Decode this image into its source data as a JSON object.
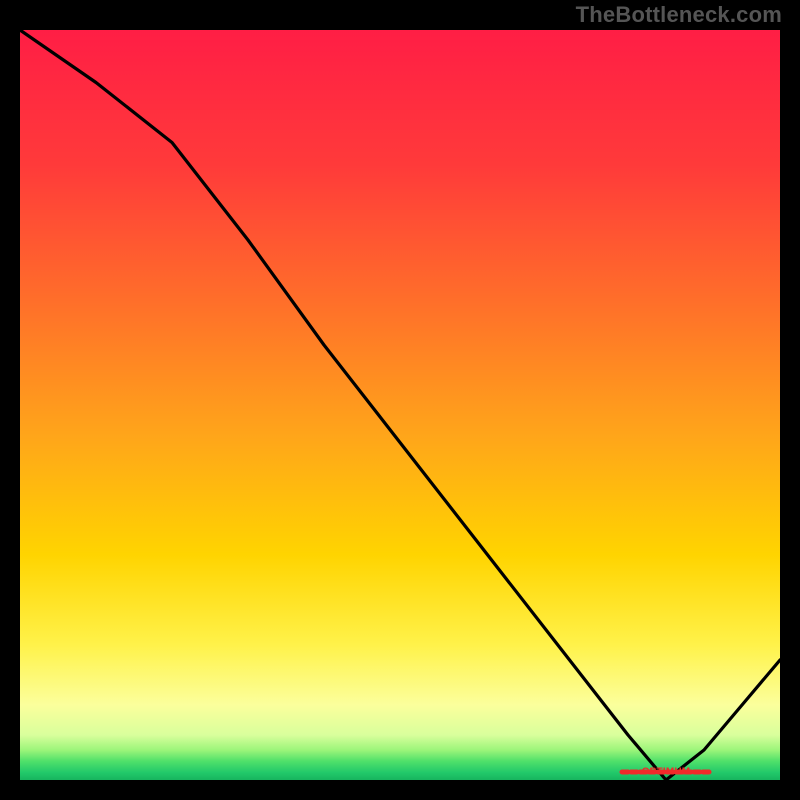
{
  "watermark": "TheBottleneck.com",
  "optimum_marker_text": "OPTIMUM",
  "colors": {
    "gradient_stops": [
      {
        "t": 0.0,
        "c": "#ff1e45"
      },
      {
        "t": 0.18,
        "c": "#ff3a3a"
      },
      {
        "t": 0.36,
        "c": "#ff6e2a"
      },
      {
        "t": 0.54,
        "c": "#ffa51a"
      },
      {
        "t": 0.7,
        "c": "#ffd400"
      },
      {
        "t": 0.82,
        "c": "#fff24a"
      },
      {
        "t": 0.9,
        "c": "#fbff9c"
      },
      {
        "t": 0.94,
        "c": "#d9ff9c"
      },
      {
        "t": 0.96,
        "c": "#9cf57a"
      },
      {
        "t": 0.975,
        "c": "#4fe06a"
      },
      {
        "t": 0.99,
        "c": "#22c96a"
      },
      {
        "t": 1.0,
        "c": "#17b45e"
      }
    ],
    "curve": "#000000",
    "background": "#000000"
  },
  "chart_data": {
    "type": "line",
    "title": "",
    "xlabel": "",
    "ylabel": "",
    "xlim": [
      0,
      100
    ],
    "ylim": [
      0,
      100
    ],
    "optimum_x": 85,
    "series": [
      {
        "name": "bottleneck-curve",
        "x": [
          0,
          10,
          20,
          30,
          40,
          50,
          60,
          70,
          80,
          85,
          90,
          95,
          100
        ],
        "values": [
          100,
          93,
          85,
          72,
          58,
          45,
          32,
          19,
          6,
          0,
          4,
          10,
          16
        ]
      }
    ]
  }
}
